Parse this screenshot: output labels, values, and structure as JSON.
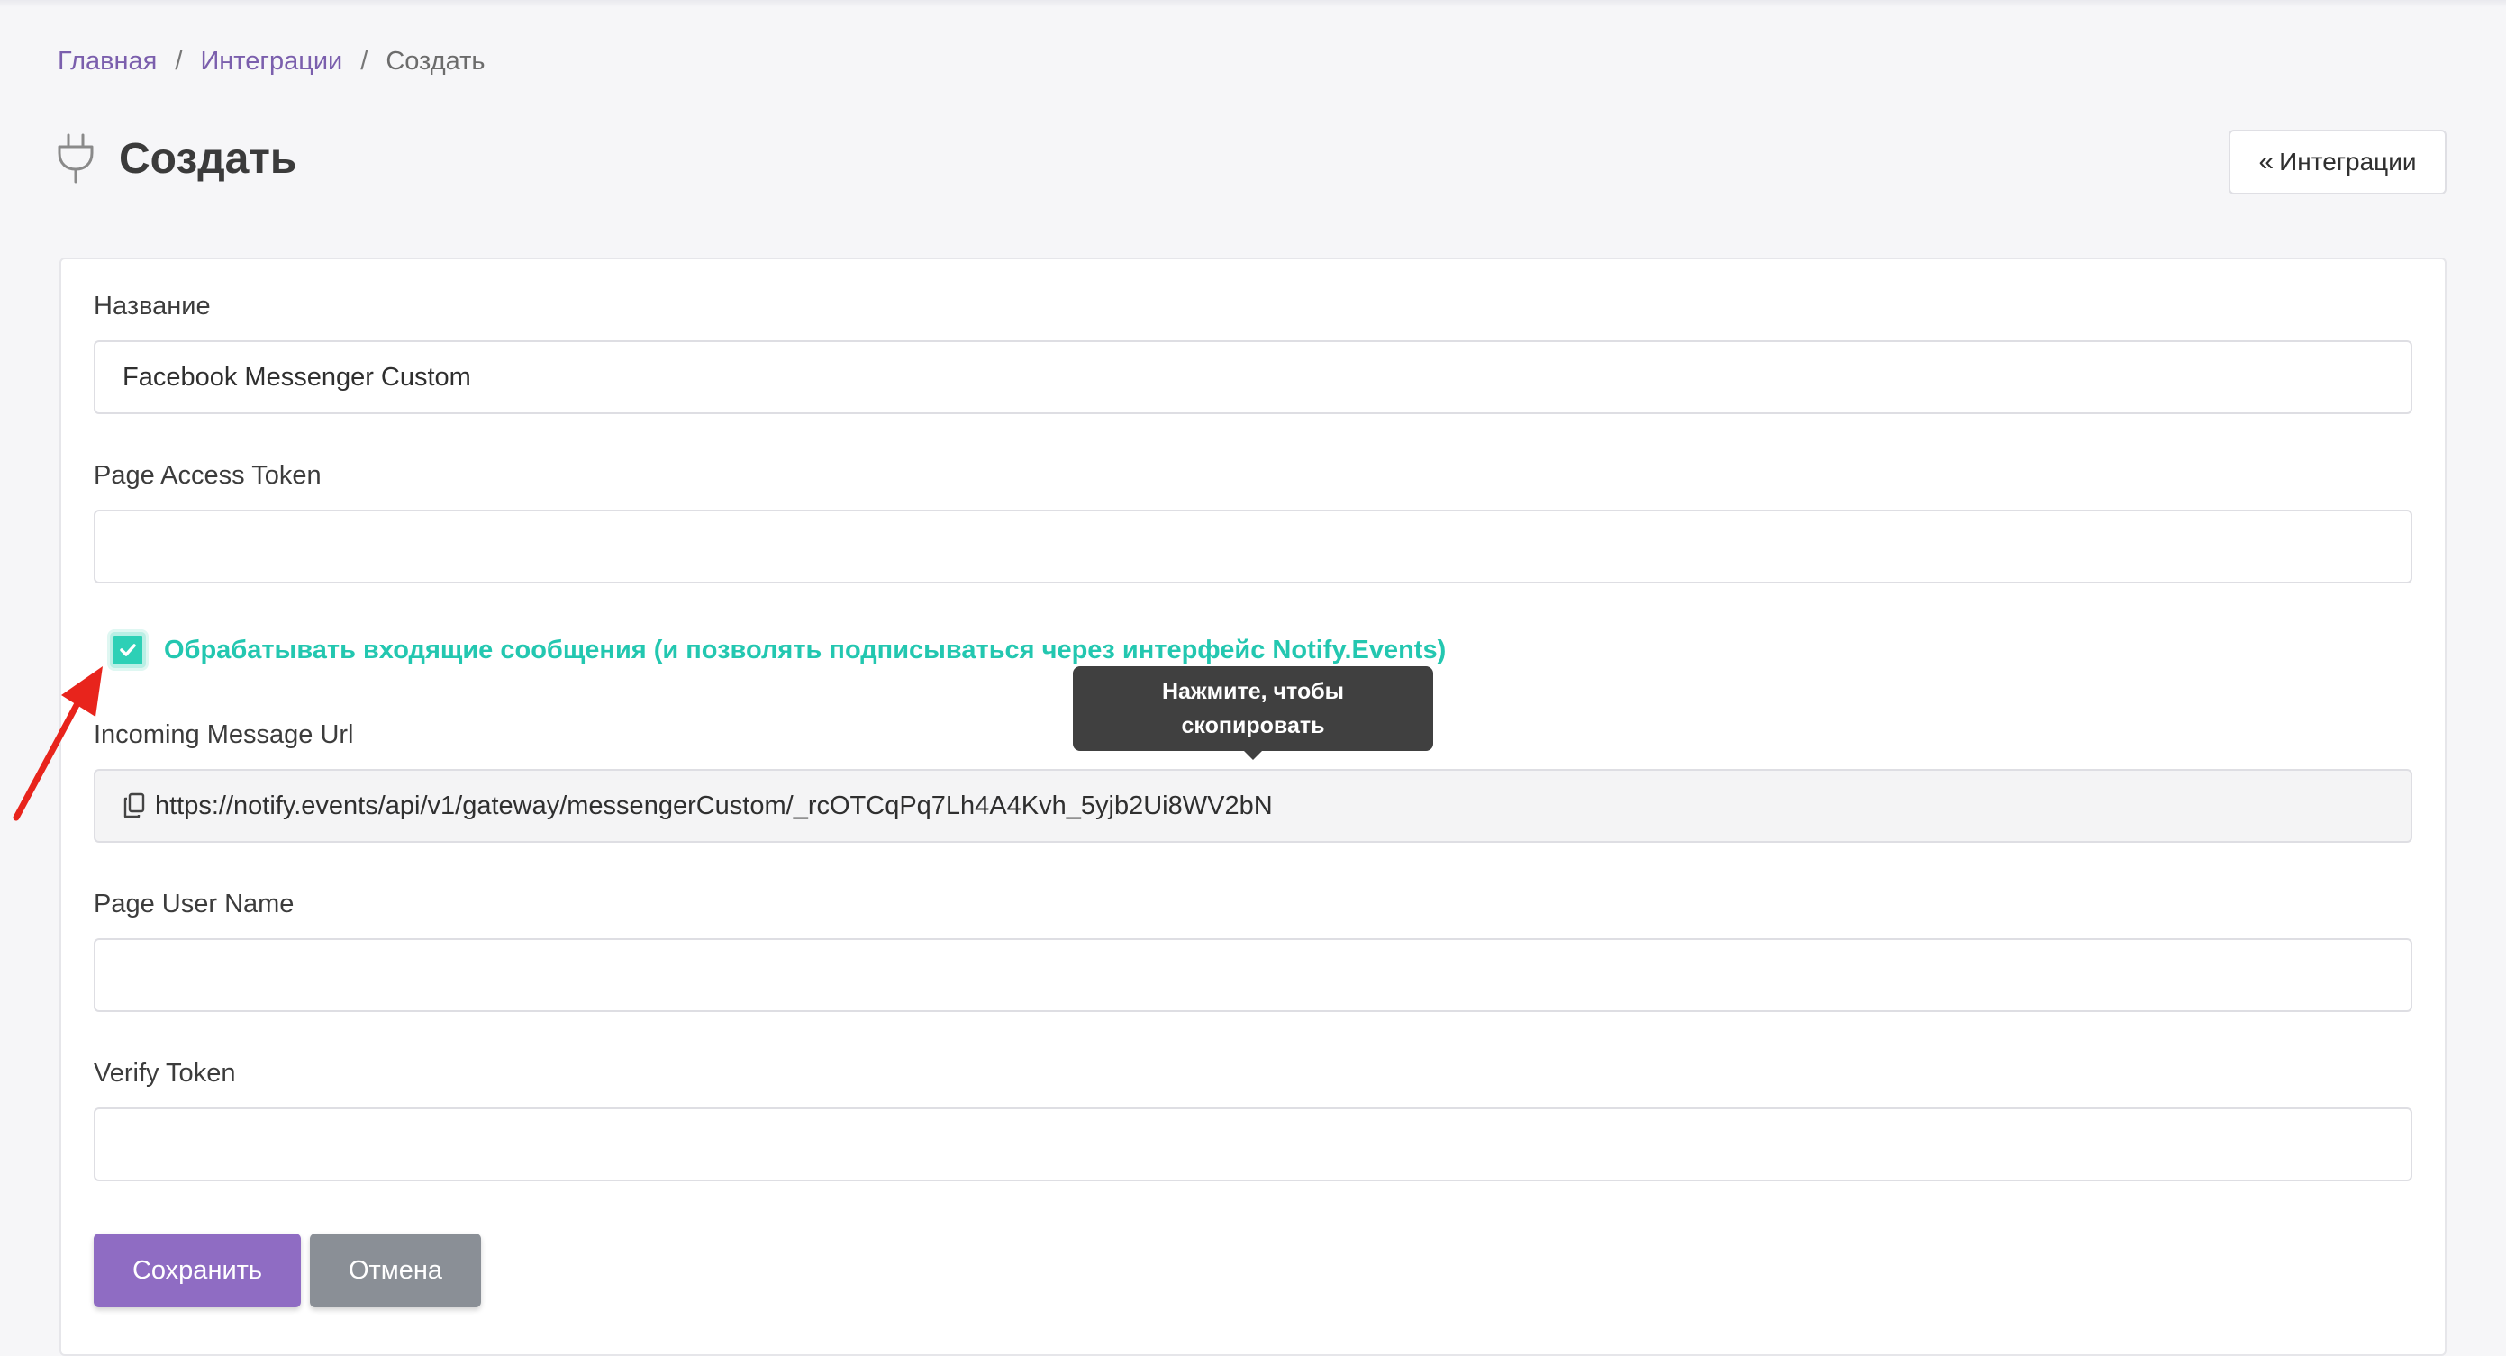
{
  "breadcrumb": {
    "home": "Главная",
    "integrations": "Интеграции",
    "current": "Создать",
    "separator": "/"
  },
  "page": {
    "title": "Создать",
    "icon": "plug-icon",
    "back_button_label": "Интеграции",
    "back_button_icon": "double-chevron-left-icon"
  },
  "form": {
    "name": {
      "label": "Название",
      "value": "Facebook Messenger Custom"
    },
    "page_access_token": {
      "label": "Page Access Token",
      "value": ""
    },
    "process_incoming": {
      "label": "Обрабатывать входящие сообщения (и позволять подписываться через интерфейс Notify.Events)",
      "checked": true
    },
    "incoming_message_url": {
      "label": "Incoming Message Url",
      "value": "https://notify.events/api/v1/gateway/messengerCustom/_rcOTCqPq7Lh4A4Kvh_5yjb2Ui8WV2bN",
      "icon": "copy-icon",
      "tooltip": "Нажмите, чтобы скопировать"
    },
    "page_user_name": {
      "label": "Page User Name",
      "value": ""
    },
    "verify_token": {
      "label": "Verify Token",
      "value": ""
    },
    "save_label": "Сохранить",
    "cancel_label": "Отмена"
  },
  "colors": {
    "accent_purple": "#8f6cc3",
    "link_purple": "#7b5fad",
    "teal": "#23c7b0",
    "cancel_gray": "#8a8f96",
    "annotation_red": "#e8241c"
  },
  "annotation": {
    "icon": "red-arrow-icon"
  }
}
